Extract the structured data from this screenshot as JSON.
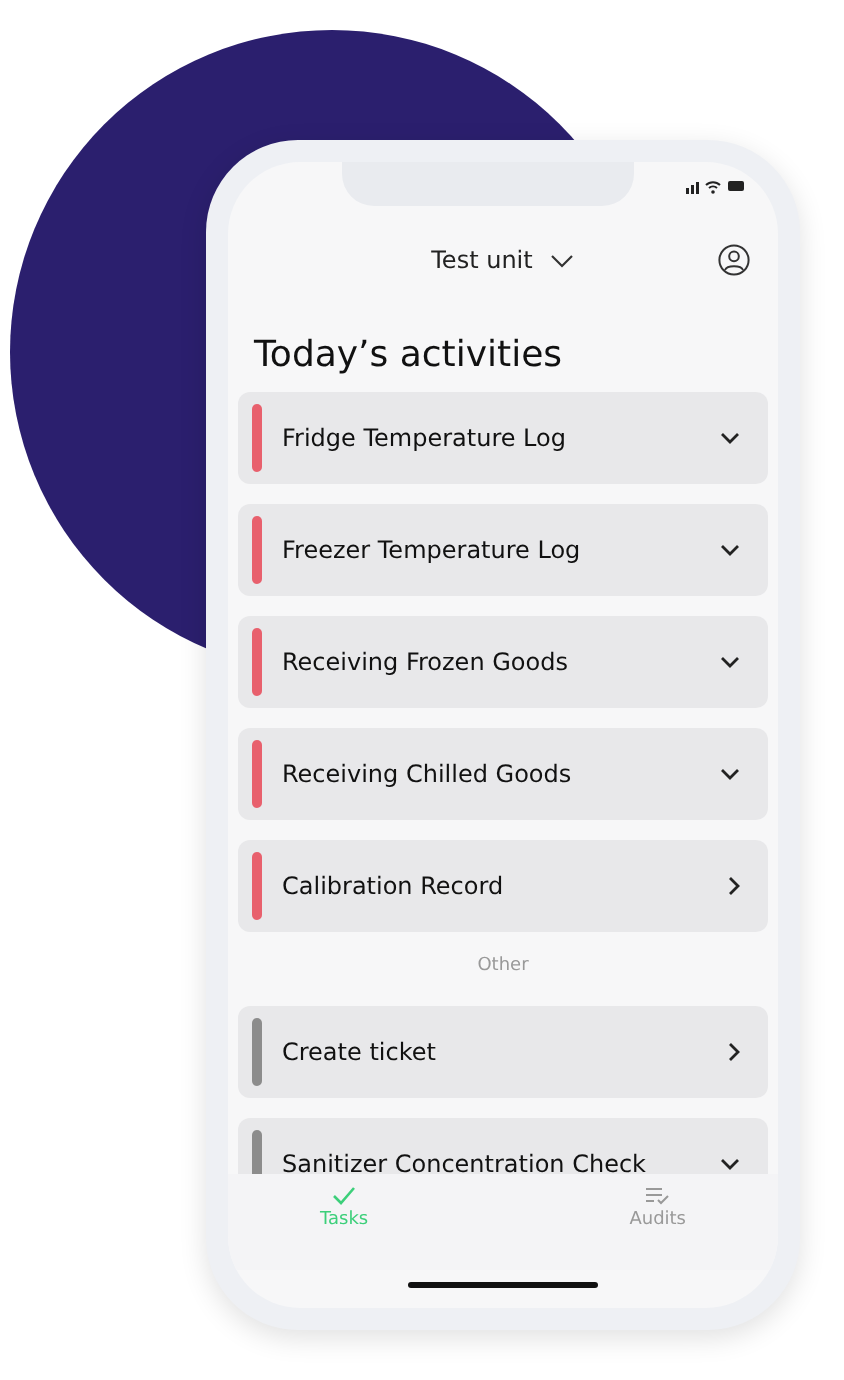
{
  "header": {
    "unit": "Test unit"
  },
  "title": "Today’s activities",
  "activities": [
    {
      "label": "Fridge Temperature Log",
      "kind": "expand",
      "color": "#e8606d"
    },
    {
      "label": "Freezer Temperature Log",
      "kind": "expand",
      "color": "#e8606d"
    },
    {
      "label": "Receiving Frozen Goods",
      "kind": "expand",
      "color": "#e8606d"
    },
    {
      "label": "Receiving Chilled Goods",
      "kind": "expand",
      "color": "#e8606d"
    },
    {
      "label": "Calibration Record",
      "kind": "link",
      "color": "#e8606d"
    }
  ],
  "other_heading": "Other",
  "other": [
    {
      "label": "Create ticket",
      "kind": "link",
      "color": "#8c8c8c"
    },
    {
      "label": "Sanitizer Concentration Check",
      "kind": "expand",
      "color": "#8c8c8c"
    }
  ],
  "tabs": [
    {
      "label": "Tasks",
      "kind": "tasks",
      "selected": true
    },
    {
      "label": "Audits",
      "kind": "audits",
      "selected": false
    }
  ]
}
